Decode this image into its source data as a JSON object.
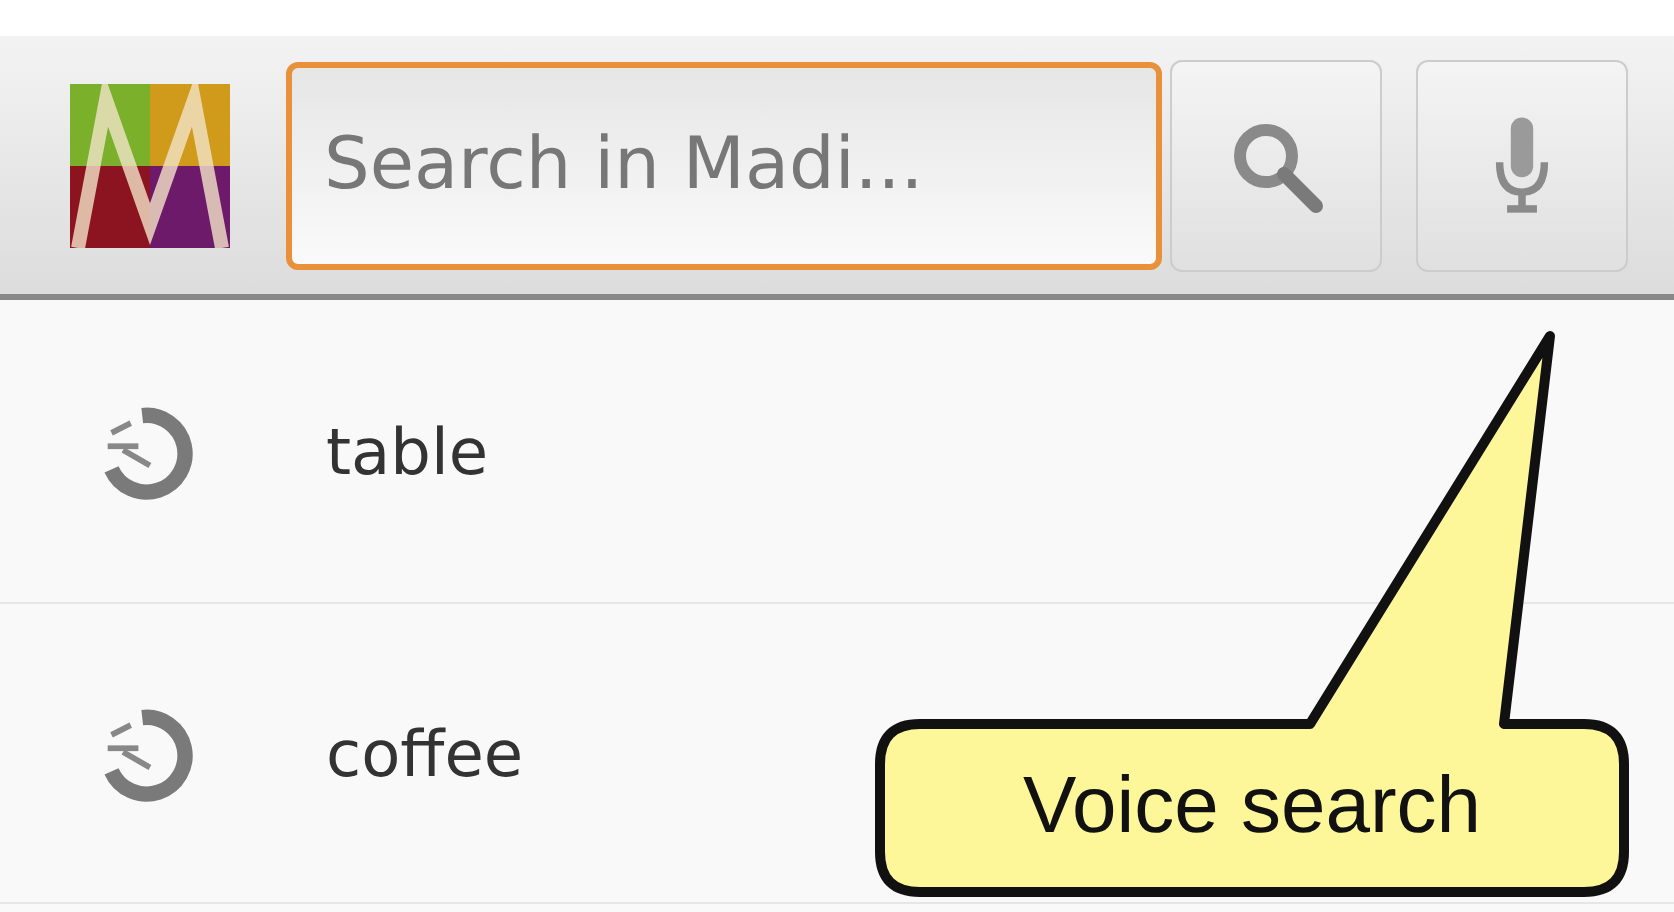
{
  "search": {
    "placeholder": "Search in Madi..."
  },
  "suggestions": [
    {
      "label": "table"
    },
    {
      "label": "coffee"
    }
  ],
  "callout": {
    "text": "Voice search"
  }
}
